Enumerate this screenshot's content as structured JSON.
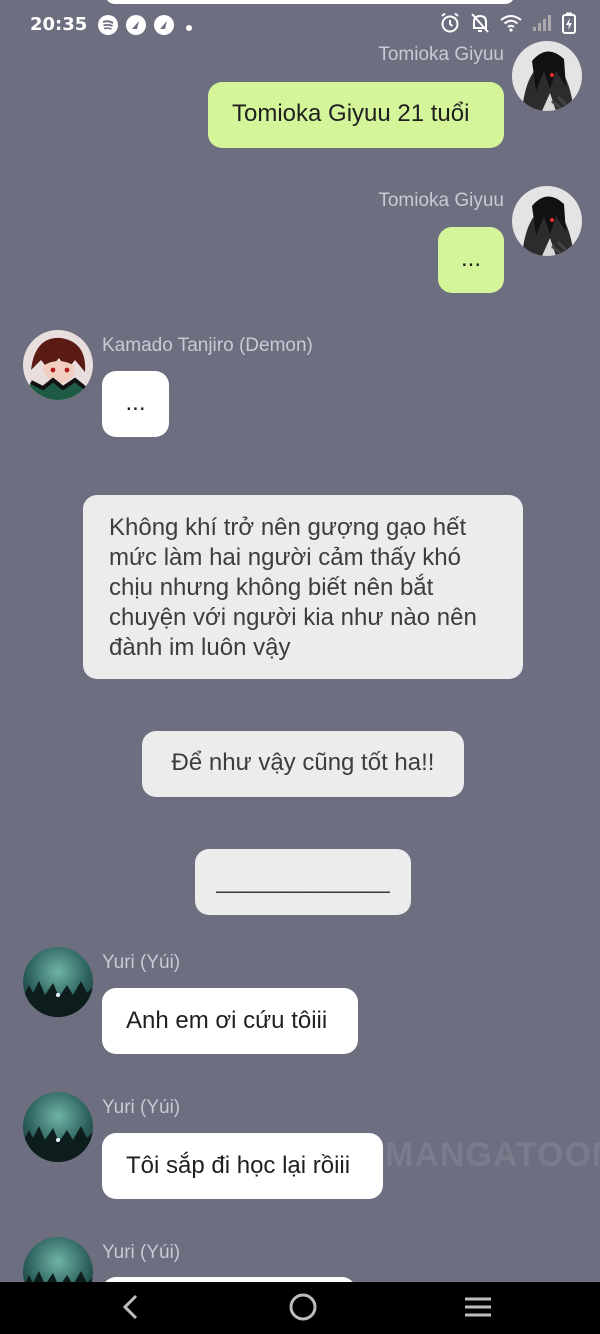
{
  "status_bar": {
    "time": "20:35",
    "app_icons": [
      "spotify-icon",
      "navigation-icon",
      "navigation-icon",
      "dot-icon"
    ],
    "system_icons": [
      "alarm-icon",
      "mute-icon",
      "wifi-icon",
      "signal-icon",
      "battery-charging-icon"
    ]
  },
  "messages": [
    {
      "sender": "Tomioka Giyuu",
      "text": "Tomioka Giyuu 21 tuổi",
      "side": "right"
    },
    {
      "sender": "Tomioka Giyuu",
      "text": "...",
      "side": "right"
    },
    {
      "sender": "Kamado Tanjiro (Demon)",
      "text": "...",
      "side": "left"
    },
    {
      "narration": "Không khí trở nên gượng gạo hết mức làm hai người cảm thấy khó chịu nhưng không biết nên bắt chuyện với người kia như nào nên đành im luôn vậy"
    },
    {
      "narration": "Để như vậy cũng tốt ha!!"
    },
    {
      "narration": "_____________"
    },
    {
      "sender": "Yuri (Yúi)",
      "text": "Anh em ơi cứu tôiii",
      "side": "left"
    },
    {
      "sender": "Yuri (Yúi)",
      "text": "Tôi sắp đi học lại rồiii",
      "side": "left"
    },
    {
      "sender": "Yuri (Yúi)",
      "text": "",
      "side": "left"
    }
  ],
  "watermark": "MANGATOON",
  "nav": [
    "back-icon",
    "home-icon",
    "menu-icon"
  ],
  "colors": {
    "background": "#6d6e80",
    "right_bubble": "#d5f59b",
    "left_bubble": "#ffffff",
    "narration_bubble": "#ececec",
    "sender_name": "#c9cad3"
  }
}
